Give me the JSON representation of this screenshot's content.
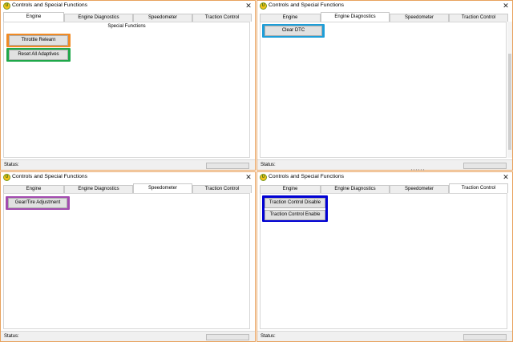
{
  "app": {
    "title": "Controls and Special Functions",
    "close_glyph": "✕",
    "icon_glyph": "U"
  },
  "tabs": [
    "Engine",
    "Engine Diagnostics",
    "Speedometer",
    "Traction Control"
  ],
  "status": {
    "label": "Status:"
  },
  "colors": {
    "orange": "#f08a24",
    "green": "#1fa84a",
    "cyan": "#1e9ed8",
    "purple": "#a34bb0",
    "blue": "#0000d4"
  },
  "windows": {
    "engine": {
      "section_label": "Special Functions",
      "buttons": {
        "throttle": "Throttle Relearn",
        "reset": "Reset All Adaptives"
      }
    },
    "engine_diagnostics": {
      "buttons": {
        "clear_dtc": "Clear DTC"
      }
    },
    "speedometer": {
      "buttons": {
        "gear_tire": "Gear/Tire Adjustment"
      }
    },
    "traction_control": {
      "buttons": {
        "disable": "Traction Control Disable",
        "enable": "Traction Control Enable"
      }
    }
  }
}
